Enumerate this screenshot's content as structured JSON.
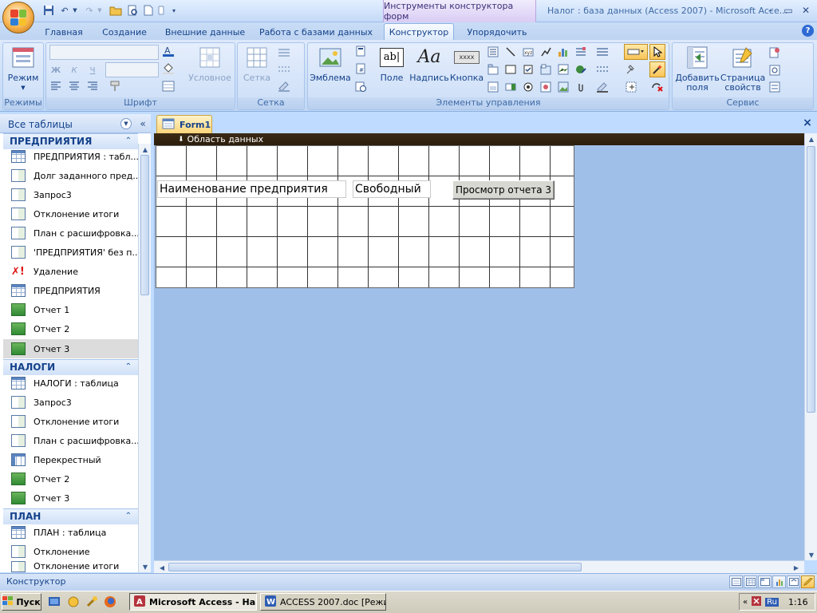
{
  "window": {
    "context_tools_title": "Инструменты конструктора форм",
    "title": "Налог : база данных (Access 2007) - Microsoft Acce...",
    "minimize": "–",
    "maximize": "▭",
    "close": "✕"
  },
  "ribbon_tabs": [
    {
      "label": "Главная"
    },
    {
      "label": "Создание"
    },
    {
      "label": "Внешние данные"
    },
    {
      "label": "Работа с базами данных"
    },
    {
      "label": "Конструктор"
    },
    {
      "label": "Упорядочить"
    }
  ],
  "ribbon": {
    "groups": {
      "modes": "Режимы",
      "font": "Шрифт",
      "grid": "Сетка",
      "controls": "Элементы управления",
      "service": "Сервис"
    },
    "buttons": {
      "mode": "Режим",
      "conditional": "Условное",
      "grid": "Сетка",
      "logo": "Эмблема",
      "field": "Поле",
      "label": "Надпись",
      "button": "Кнопка",
      "add_fields": "Добавить поля",
      "property_sheet": "Страница свойств"
    },
    "font_bold": "Ж",
    "font_italic": "К",
    "font_underline": "Ч",
    "button_preview": "xxxx",
    "field_preview": "ab|"
  },
  "nav": {
    "header": "Все таблицы",
    "sections": [
      {
        "title": "ПРЕДПРИЯТИЯ",
        "items": [
          {
            "label": "ПРЕДПРИЯТИЯ : табл...",
            "icon": "table"
          },
          {
            "label": "Долг заданного пред...",
            "icon": "query"
          },
          {
            "label": "Запрос3",
            "icon": "query"
          },
          {
            "label": "Отклонение итоги",
            "icon": "query"
          },
          {
            "label": "План с расшифровка...",
            "icon": "query"
          },
          {
            "label": "'ПРЕДПРИЯТИЯ' без п...",
            "icon": "query"
          },
          {
            "label": "Удаление",
            "icon": "delete"
          },
          {
            "label": "ПРЕДПРИЯТИЯ",
            "icon": "form"
          },
          {
            "label": "Отчет 1",
            "icon": "report"
          },
          {
            "label": "Отчет 2",
            "icon": "report"
          },
          {
            "label": "Отчет 3",
            "icon": "report",
            "selected": true
          }
        ]
      },
      {
        "title": "НАЛОГИ",
        "items": [
          {
            "label": "НАЛОГИ : таблица",
            "icon": "table"
          },
          {
            "label": "Запрос3",
            "icon": "query"
          },
          {
            "label": "Отклонение итоги",
            "icon": "query"
          },
          {
            "label": "План с расшифровка...",
            "icon": "query"
          },
          {
            "label": "Перекрестный",
            "icon": "crosstab"
          },
          {
            "label": "Отчет 2",
            "icon": "report"
          },
          {
            "label": "Отчет 3",
            "icon": "report"
          }
        ]
      },
      {
        "title": "ПЛАН",
        "items": [
          {
            "label": "ПЛАН : таблица",
            "icon": "table"
          },
          {
            "label": "Отклонение",
            "icon": "query"
          },
          {
            "label": "Отклонение итоги",
            "icon": "query"
          }
        ]
      }
    ]
  },
  "document": {
    "tab": "Form1",
    "close": "×",
    "section": "Область данных",
    "label_name": "Наименование предприятия",
    "label_free": "Свободный",
    "button_report": "Просмотр отчета 3"
  },
  "status": {
    "text": "Конструктор"
  },
  "taskbar": {
    "start": "Пуск",
    "tasks": [
      {
        "label": "Microsoft Access - На...",
        "active": true
      },
      {
        "label": "ACCESS 2007.doc [Режи...",
        "active": false
      }
    ],
    "lang": "Ru",
    "time": "1:16"
  }
}
